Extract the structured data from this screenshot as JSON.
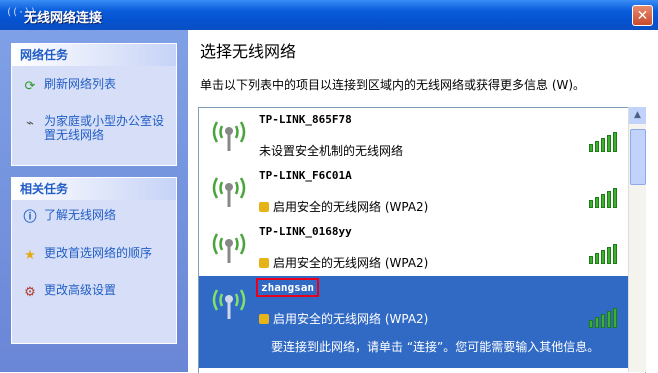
{
  "window": {
    "title": "无线网络连接",
    "title_icon": "((·))",
    "close_glyph": "✕"
  },
  "sidebar": {
    "network_tasks": {
      "title": "网络任务",
      "items": [
        {
          "icon": "refresh-icon",
          "label": "刷新网络列表"
        },
        {
          "icon": "network-setup-icon",
          "label": "为家庭或小型办公室设置无线网络"
        }
      ]
    },
    "related_tasks": {
      "title": "相关任务",
      "items": [
        {
          "icon": "info-icon",
          "label": "了解无线网络"
        },
        {
          "icon": "star-icon",
          "label": "更改首选网络的顺序"
        },
        {
          "icon": "settings-icon",
          "label": "更改高级设置"
        }
      ]
    }
  },
  "main": {
    "heading": "选择无线网络",
    "description": "单击以下列表中的项目以连接到区域内的无线网络或获得更多信息 (W)。"
  },
  "networks": [
    {
      "ssid": "TP-LINK_865F78",
      "security": "未设置安全机制的无线网络",
      "secured": false,
      "signal_bars": 5,
      "selected": false
    },
    {
      "ssid": "TP-LINK_F6C01A",
      "security": "启用安全的无线网络 (WPA2)",
      "secured": true,
      "signal_bars": 5,
      "selected": false
    },
    {
      "ssid": "TP-LINK_0168yy",
      "security": "启用安全的无线网络 (WPA2)",
      "secured": true,
      "signal_bars": 5,
      "selected": false
    },
    {
      "ssid": "zhangsan",
      "security": "启用安全的无线网络 (WPA2)",
      "secured": true,
      "signal_bars": 5,
      "selected": true,
      "hint": "要连接到此网络，请单击 “连接”。您可能需要输入其他信息。"
    }
  ],
  "colors": {
    "accent": "#316ac5",
    "highlight_border": "#e8001c",
    "signal": "#3cb02f"
  }
}
